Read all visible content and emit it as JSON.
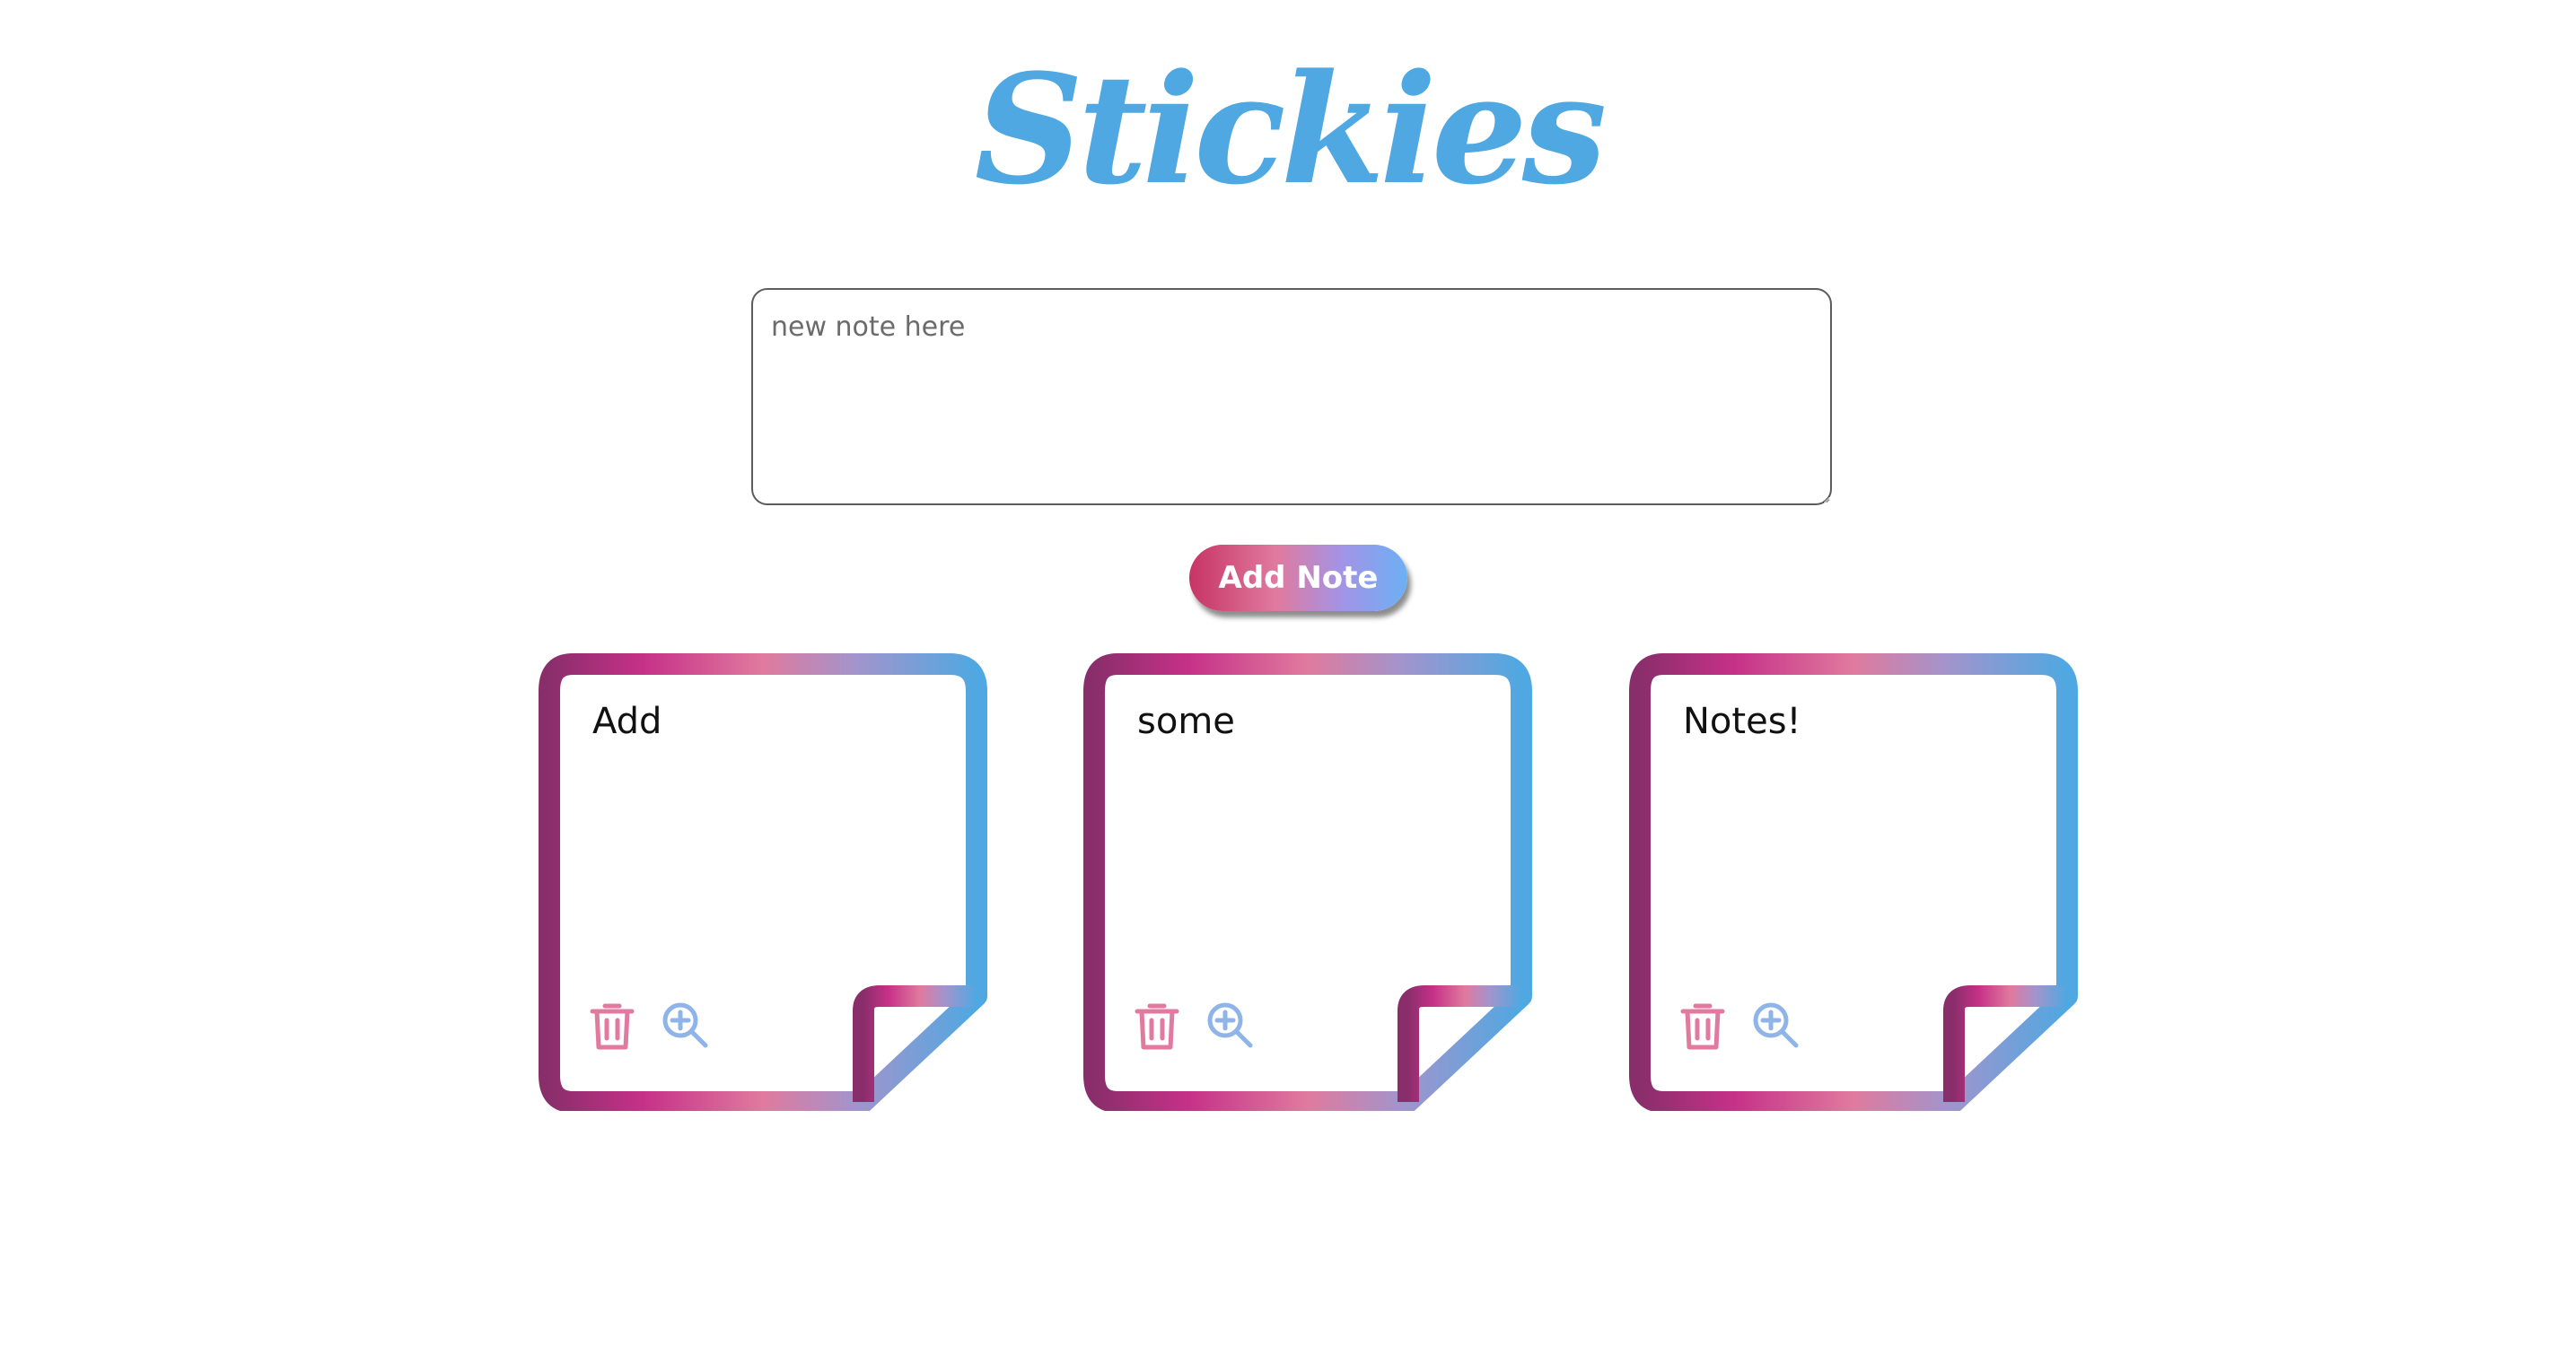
{
  "app": {
    "title": "Stickies"
  },
  "composer": {
    "placeholder": "new note here",
    "value": "",
    "add_label": "Add Note"
  },
  "notes": [
    {
      "text": "Add"
    },
    {
      "text": "some"
    },
    {
      "text": "Notes!"
    }
  ],
  "note_actions": {
    "delete_icon": "trash-icon",
    "zoom_icon": "zoom-in-icon"
  },
  "colors": {
    "title": "#4fa8e2",
    "gradient": [
      "#8a2e6b",
      "#c63188",
      "#e07a9e",
      "#a294cc",
      "#4fa8e2"
    ],
    "delete_icon": "#e07a9e",
    "zoom_icon": "#8fb4ea"
  }
}
